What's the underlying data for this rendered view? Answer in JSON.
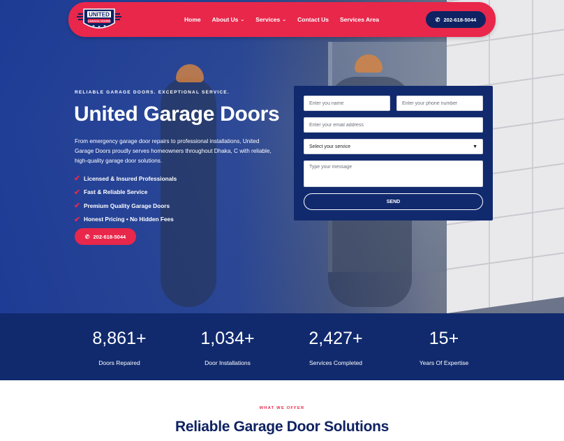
{
  "brand": {
    "logo_text_top": "UNITED",
    "logo_text_bottom": "GARAGE DOORS",
    "primary_color": "#e8274b",
    "navy_color": "#112a6e"
  },
  "nav": {
    "items": [
      {
        "label": "Home",
        "has_dropdown": false
      },
      {
        "label": "About Us",
        "has_dropdown": true
      },
      {
        "label": "Services",
        "has_dropdown": true
      },
      {
        "label": "Contact Us",
        "has_dropdown": false
      },
      {
        "label": "Services Area",
        "has_dropdown": false
      }
    ],
    "phone": "202-618-5044",
    "dropdown_icon": "chevron-down-icon",
    "phone_icon": "phone-icon"
  },
  "hero": {
    "eyebrow": "RELIABLE GARAGE DOORS. EXCEPTIONAL SERVICE.",
    "title": "United Garage Doors",
    "description": "From emergency garage door repairs to professional installations, United Garage Doors proudly serves homeowners throughout Dhaka, C with reliable, high-quality garage door solutions.",
    "features": [
      "Licensed & Insured Professionals",
      "Fast & Reliable Service",
      "Premium Quality Garage Doors",
      "Honest Pricing • No Hidden Fees"
    ],
    "feature_icon": "check-icon",
    "phone": "202-618-5044"
  },
  "form": {
    "name_placeholder": "Enter you name",
    "phone_placeholder": "Enter your phone number",
    "email_placeholder": "Enter your email address",
    "service_selected": "Select your service",
    "message_placeholder": "Type your message",
    "send_label": "SEND"
  },
  "stats": [
    {
      "value": "8,861+",
      "label": "Doors Repaired"
    },
    {
      "value": "1,034+",
      "label": "Door Installations"
    },
    {
      "value": "2,427+",
      "label": "Services Completed"
    },
    {
      "value": "15+",
      "label": "Years Of Expertise"
    }
  ],
  "offer": {
    "eyebrow": "WHAT WE OFFER",
    "title": "Reliable Garage Door Solutions"
  }
}
